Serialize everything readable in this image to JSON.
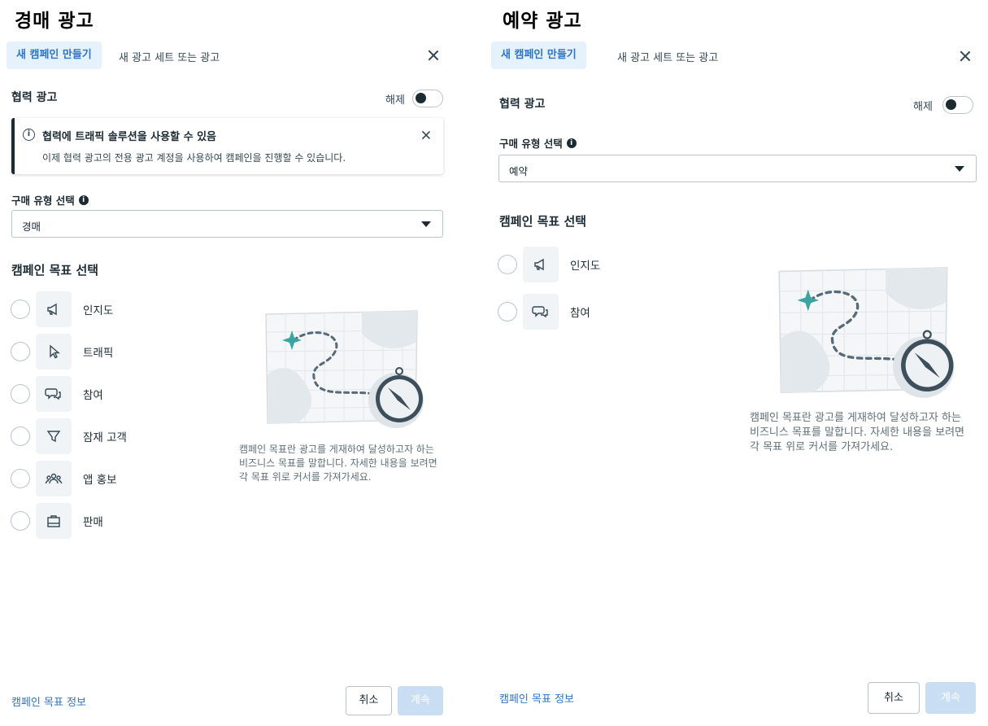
{
  "left": {
    "heading": "경매 광고",
    "tab_active": "새 캠페인 만들기",
    "tab_inactive": "새 광고 세트 또는 광고",
    "partner_ads_label": "협력 광고",
    "toggle_label": "해제",
    "notice": {
      "title": "협력에 트래픽 솔루션을 사용할 수 있음",
      "body": "이제 협력 광고의 전용 광고 계정을 사용하여 캠페인을 진행할 수 있습니다."
    },
    "buying_type_label": "구매 유형 선택",
    "buying_type_value": "경매",
    "objective_heading": "캠페인 목표 선택",
    "objectives": [
      {
        "label": "인지도",
        "icon": "megaphone-icon"
      },
      {
        "label": "트래픽",
        "icon": "cursor-icon"
      },
      {
        "label": "참여",
        "icon": "chat-bubbles-icon"
      },
      {
        "label": "잠재 고객",
        "icon": "funnel-icon"
      },
      {
        "label": "앱 홍보",
        "icon": "people-icon"
      },
      {
        "label": "판매",
        "icon": "shopping-bag-icon"
      }
    ],
    "description": "캠페인 목표란 광고를 게재하여 달성하고자 하는 비즈니스 목표를 말합니다. 자세한 내용을 보려면 각 목표 위로 커서를 가져가세요.",
    "footer_link": "캠페인 목표 정보",
    "cancel_label": "취소",
    "continue_label": "계속"
  },
  "right": {
    "heading": "예약 광고",
    "tab_active": "새 캠페인 만들기",
    "tab_inactive": "새 광고 세트 또는 광고",
    "partner_ads_label": "협력 광고",
    "toggle_label": "해제",
    "buying_type_label": "구매 유형 선택",
    "buying_type_value": "예약",
    "objective_heading": "캠페인 목표 선택",
    "objectives": [
      {
        "label": "인지도",
        "icon": "megaphone-icon"
      },
      {
        "label": "참여",
        "icon": "chat-bubbles-icon"
      }
    ],
    "description": "캠페인 목표란 광고를 게재하여 달성하고자 하는 비즈니스 목표를 말합니다. 자세한 내용을 보려면 각 목표 위로 커서를 가져가세요.",
    "footer_link": "캠페인 목표 정보",
    "cancel_label": "취소",
    "continue_label": "계속"
  },
  "colors": {
    "accent": "#2e74c9",
    "tab_bg": "#e6f2fb",
    "continue_disabled": "#c9def2",
    "text": "#1c2b33"
  }
}
